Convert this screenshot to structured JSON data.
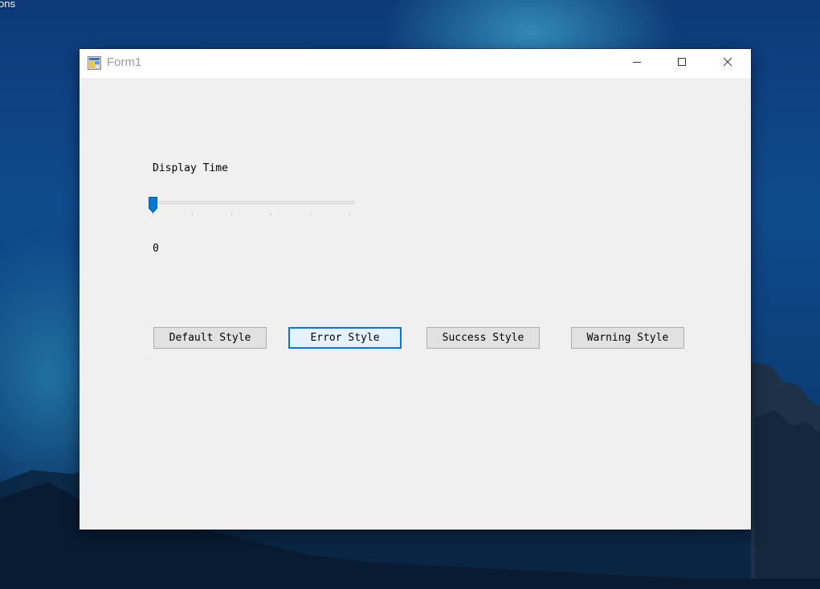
{
  "desktop": {
    "label": "ons"
  },
  "window": {
    "title": "Form1",
    "icon": "winforms-app-icon",
    "controls": {
      "minimize": "minimize-icon",
      "maximize": "maximize-icon",
      "close": "close-icon"
    }
  },
  "form": {
    "display_time_label": "Display Time",
    "trackbar": {
      "value": 0,
      "tick_count": 6
    },
    "value_text": "0",
    "buttons": {
      "default": "Default Style",
      "error": "Error Style",
      "success": "Success Style",
      "warning": "Warning Style"
    },
    "focused_button": "error"
  },
  "colors": {
    "accent": "#0078d7",
    "window_background": "#f0f0f0",
    "titlebar": "#ffffff",
    "title_text": "#9a9a9a"
  }
}
